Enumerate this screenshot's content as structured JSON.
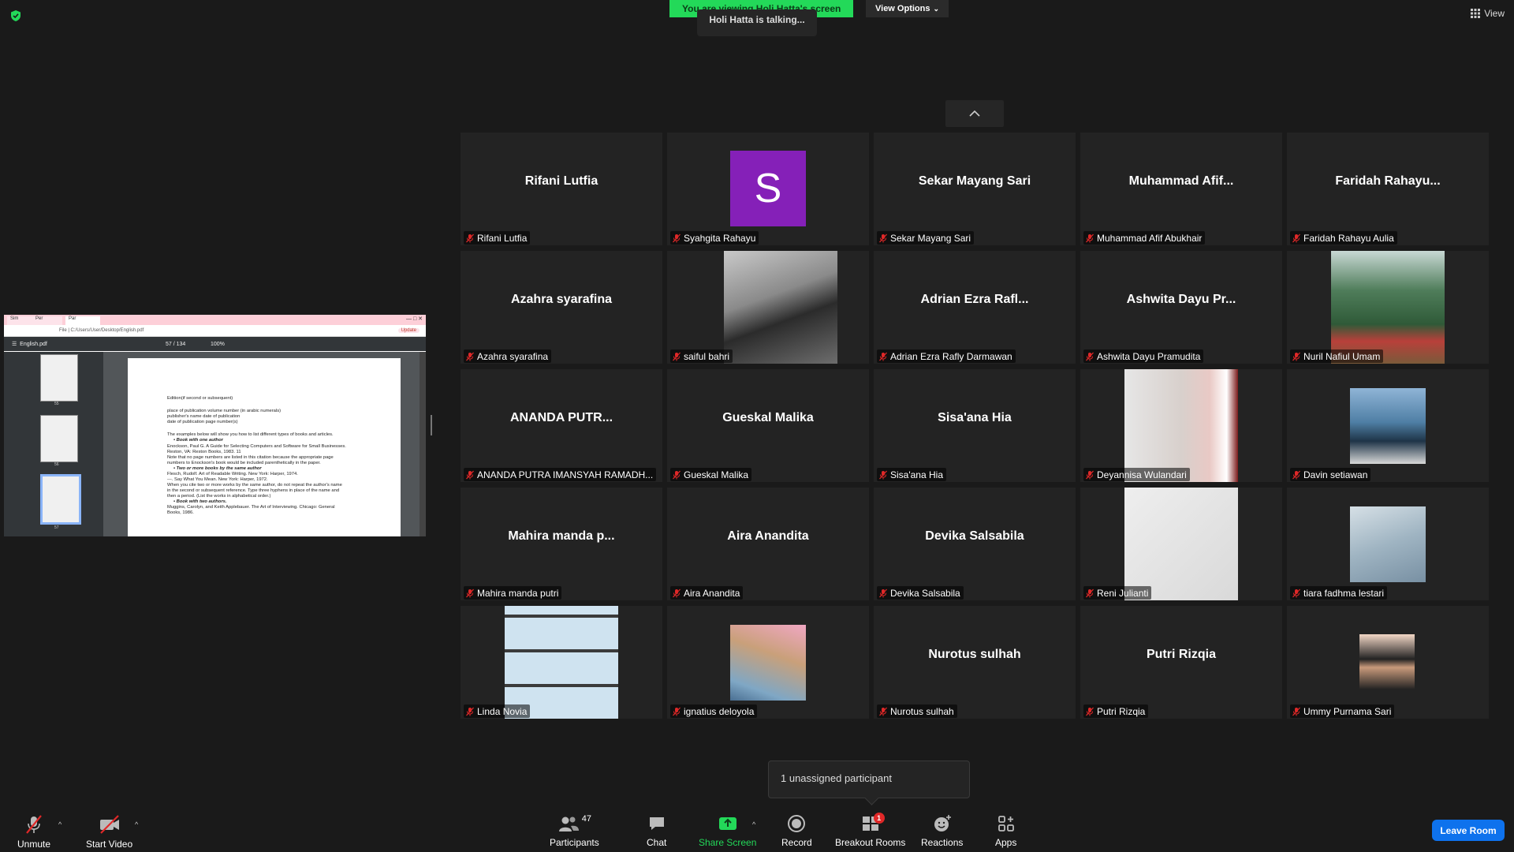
{
  "banner": {
    "text": "You are viewing Holi Hatta's screen",
    "color": "#23d959"
  },
  "view_options": {
    "label": "View Options"
  },
  "talking_indicator": "Holi Hatta is talking...",
  "view_button": {
    "label": "View"
  },
  "shared_screen": {
    "file_name": "English.pdf",
    "address": "File | C:/Users/User/Desktop/English.pdf",
    "page_indicator": "57 / 134",
    "zoom": "100%",
    "update_label": "Update",
    "thumbnails": [
      "55",
      "56",
      "57"
    ],
    "lines": [
      "Edition(if second or subsequent)",
      "place of publication                          volume number (in arabic numerals)",
      "publisher's name                                  date of publication",
      "date of publication                                page number(s)",
      "The examples below will show you how to list different types of books and articles.",
      "•     Book with one author",
      "Enockson, Paul G. A Guide for Selecting Computers and  Software for Small Businesses.",
      "Reston, VA: Reston Books, 1983.        11",
      "Note that no page numbers are listed in this citation because the appropriate page",
      "numbers to Enockson's book would be included parenthetically in the paper.",
      "•     Two or more books by the same author",
      "Flesch, Rudolf. Art of Readable Writing. New York: Harper, 1974.",
      "---. Say What You Mean. New York: Harper, 1972.",
      "When you cite two or more works by the same author, do not repeat the author's name",
      "in the second or subsequent reference. Type three hyphens in place of the name and",
      "then a period. (List the works in alphabetical order.)",
      "•     Book with two authors.",
      "Muggins, Carolyn, and Keith Applebauer. The Art of Interviewing. Chicago: General",
      "Books, 1986."
    ]
  },
  "participants": [
    {
      "display": "Rifani Lutfia",
      "name": "Rifani Lutfia",
      "media": "text"
    },
    {
      "display": "S",
      "name": "Syahgita Rahayu",
      "media": "avatar",
      "avatar_color": "#8520b8"
    },
    {
      "display": "Sekar Mayang Sari",
      "name": "Sekar Mayang Sari",
      "media": "text"
    },
    {
      "display": "Muhammad  Afif...",
      "name": "Muhammad Afif Abukhair",
      "media": "text"
    },
    {
      "display": "Faridah  Rahayu...",
      "name": "Faridah Rahayu Aulia",
      "media": "text"
    },
    {
      "display": "Azahra syarafina",
      "name": "Azahra syarafina",
      "media": "text"
    },
    {
      "display": "",
      "name": "saiful bahri",
      "media": "photo-selfie"
    },
    {
      "display": "Adrian Ezra Rafl...",
      "name": "Adrian Ezra Rafly Darmawan",
      "media": "text"
    },
    {
      "display": "Ashwita Dayu Pr...",
      "name": "Ashwita Dayu Pramudita",
      "media": "text"
    },
    {
      "display": "",
      "name": "Nuril Nafiul Umam",
      "media": "photo-bridge"
    },
    {
      "display": "ANANDA  PUTR...",
      "name": "ANANDA PUTRA IMANSYAH RAMADH...",
      "media": "text"
    },
    {
      "display": "Gueskal Malika",
      "name": "Gueskal Malika",
      "media": "text"
    },
    {
      "display": "Sisa'ana Hia",
      "name": "Sisa'ana Hia",
      "media": "text"
    },
    {
      "display": "",
      "name": "Deyannisa Wulandari",
      "media": "photo-hijab"
    },
    {
      "display": "",
      "name": "Davin setiawan",
      "media": "photo-sea"
    },
    {
      "display": "Mahira manda p...",
      "name": "Mahira manda putri",
      "media": "text"
    },
    {
      "display": "Aira Anandita",
      "name": "Aira Anandita",
      "media": "text"
    },
    {
      "display": "Devika Salsabila",
      "name": "Devika Salsabila",
      "media": "text"
    },
    {
      "display": "",
      "name": "Reni Julianti",
      "media": "photo-white"
    },
    {
      "display": "",
      "name": "tiara fadhma lestari",
      "media": "photo-sky"
    },
    {
      "display": "",
      "name": "Linda Novia",
      "media": "photo-window"
    },
    {
      "display": "",
      "name": "ignatius deloyola",
      "media": "photo-baby"
    },
    {
      "display": "Nurotus sulhah",
      "name": "Nurotus sulhah",
      "media": "text"
    },
    {
      "display": "Putri Rizqia",
      "name": "Putri Rizqia",
      "media": "text"
    },
    {
      "display": "",
      "name": "Ummy Purnama Sari",
      "media": "photo-portrait"
    }
  ],
  "breakout_popover": "1 unassigned participant",
  "toolbar": {
    "unmute": "Unmute",
    "start_video": "Start Video",
    "participants": "Participants",
    "participants_count": "47",
    "chat": "Chat",
    "share_screen": "Share Screen",
    "record": "Record",
    "breakout_rooms": "Breakout Rooms",
    "breakout_badge": "1",
    "reactions": "Reactions",
    "apps": "Apps",
    "leave": "Leave Room"
  },
  "colors": {
    "accent_green": "#23d959",
    "leave_blue": "#0e72ed",
    "muted_red": "#e02828",
    "badge_red": "#e02828"
  }
}
